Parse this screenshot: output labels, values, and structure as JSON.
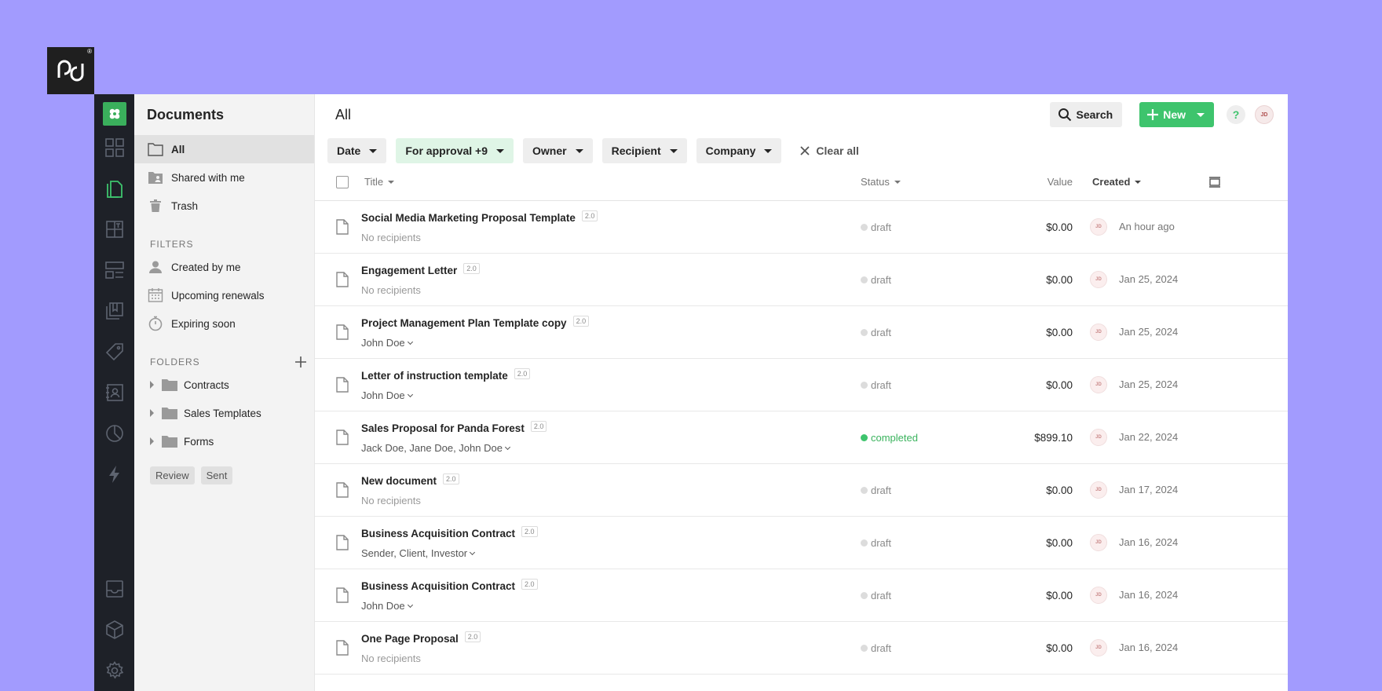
{
  "logo_text": "pd",
  "logo_mark": "®",
  "rail_icons": [
    "dashboard-icon",
    "documents-icon",
    "templates-icon",
    "content-library-icon",
    "catalog-icon",
    "tag-icon",
    "contacts-icon",
    "reports-icon",
    "automation-icon"
  ],
  "rail_bottom_icons": [
    "inbox-icon",
    "integrations-icon",
    "settings-icon"
  ],
  "sidebar": {
    "title": "Documents",
    "nav": [
      {
        "label": "All",
        "icon": "folder-icon",
        "active": true
      },
      {
        "label": "Shared with me",
        "icon": "shared-folder-icon"
      },
      {
        "label": "Trash",
        "icon": "trash-icon"
      }
    ],
    "filters_heading": "FILTERS",
    "filters": [
      {
        "label": "Created by me",
        "icon": "user-icon"
      },
      {
        "label": "Upcoming renewals",
        "icon": "calendar-icon"
      },
      {
        "label": "Expiring soon",
        "icon": "stopwatch-icon"
      }
    ],
    "folders_heading": "FOLDERS",
    "folders": [
      {
        "label": "Contracts"
      },
      {
        "label": "Sales Templates"
      },
      {
        "label": "Forms"
      }
    ],
    "tags": [
      "Review",
      "Sent"
    ]
  },
  "header": {
    "title": "All",
    "search_label": "Search",
    "new_label": "New",
    "help_label": "?",
    "avatar_initials": "JD"
  },
  "filter_chips": [
    {
      "label": "Date",
      "active": false
    },
    {
      "label": "For approval +9",
      "active": true
    },
    {
      "label": "Owner",
      "active": false
    },
    {
      "label": "Recipient",
      "active": false
    },
    {
      "label": "Company",
      "active": false
    }
  ],
  "clear_all_label": "Clear all",
  "columns": {
    "title": "Title",
    "status": "Status",
    "value": "Value",
    "created": "Created"
  },
  "rows": [
    {
      "title": "Social Media Marketing Proposal Template",
      "version": "2.0",
      "recipients": "No recipients",
      "has_recipients": false,
      "status": "draft",
      "value": "$0.00",
      "owner": "JD",
      "created": "An hour ago"
    },
    {
      "title": "Engagement Letter",
      "version": "2.0",
      "recipients": "No recipients",
      "has_recipients": false,
      "status": "draft",
      "value": "$0.00",
      "owner": "JD",
      "created": "Jan 25, 2024"
    },
    {
      "title": "Project Management Plan Template copy",
      "version": "2.0",
      "recipients": "John Doe",
      "has_recipients": true,
      "status": "draft",
      "value": "$0.00",
      "owner": "JD",
      "created": "Jan 25, 2024"
    },
    {
      "title": "Letter of instruction template",
      "version": "2.0",
      "recipients": "John Doe",
      "has_recipients": true,
      "status": "draft",
      "value": "$0.00",
      "owner": "JD",
      "created": "Jan 25, 2024"
    },
    {
      "title": "Sales Proposal for Panda Forest",
      "version": "2.0",
      "recipients": "Jack Doe, Jane Doe, John Doe",
      "has_recipients": true,
      "status": "completed",
      "value": "$899.10",
      "owner": "JD",
      "created": "Jan 22, 2024"
    },
    {
      "title": "New document",
      "version": "2.0",
      "recipients": "No recipients",
      "has_recipients": false,
      "status": "draft",
      "value": "$0.00",
      "owner": "JD",
      "created": "Jan 17, 2024"
    },
    {
      "title": "Business Acquisition Contract",
      "version": "2.0",
      "recipients": "Sender, Client, Investor",
      "has_recipients": true,
      "status": "draft",
      "value": "$0.00",
      "owner": "JD",
      "created": "Jan 16, 2024"
    },
    {
      "title": "Business Acquisition Contract",
      "version": "2.0",
      "recipients": "John Doe",
      "has_recipients": true,
      "status": "draft",
      "value": "$0.00",
      "owner": "JD",
      "created": "Jan 16, 2024"
    },
    {
      "title": "One Page Proposal",
      "version": "2.0",
      "recipients": "No recipients",
      "has_recipients": false,
      "status": "draft",
      "value": "$0.00",
      "owner": "JD",
      "created": "Jan 16, 2024"
    }
  ],
  "colors": {
    "background": "#a29bfe",
    "rail": "#1e2128",
    "accent_green": "#3ec46d",
    "chip_active": "#dff5e6"
  }
}
